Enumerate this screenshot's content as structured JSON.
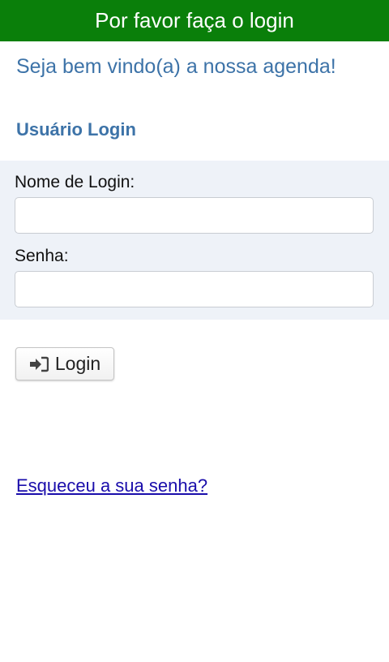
{
  "header": {
    "title": "Por favor faça o login"
  },
  "welcome_text": "Seja bem vindo(a) a nossa agenda!",
  "section_title": "Usuário Login",
  "form": {
    "login_label": "Nome de Login:",
    "login_value": "",
    "password_label": "Senha:",
    "password_value": ""
  },
  "login_button": {
    "label": "Login",
    "icon": "sign-in-icon"
  },
  "forgot_password_link": "Esqueceu a sua senha?",
  "colors": {
    "header_bg": "#0a7f0a",
    "accent_text": "#3d73a8",
    "form_panel_bg": "#eef2f8",
    "link": "#1a0dab"
  }
}
